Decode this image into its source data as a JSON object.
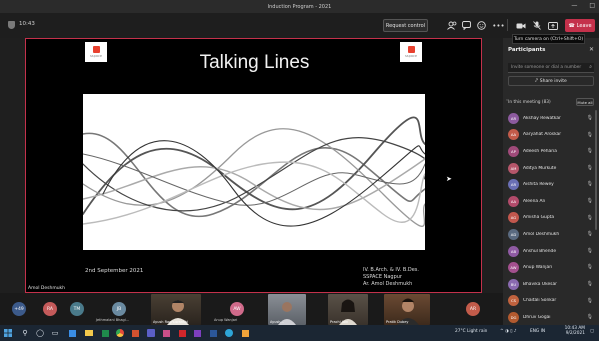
{
  "window": {
    "title": "Induction Program - 2021",
    "controls": [
      "—",
      "□"
    ]
  },
  "meeting": {
    "timer": "10:43",
    "request_control": "Request control",
    "leave_label": "Leave",
    "tooltip": "Turn camera on (Ctrl+Shift+O)"
  },
  "slide": {
    "title": "Talking Lines",
    "date": "2nd September 2021",
    "credits": [
      "IV. B.Arch. & IV. B.Des.",
      "SSPACE Nagpur",
      "Ar. Amol Deshmukh"
    ],
    "presenter": "Amol Deshmukh",
    "logo_text": "sspace"
  },
  "participants": {
    "title": "Participants",
    "invite_placeholder": "Invite someone or dial a number",
    "share_invite": "Share invite",
    "section": "In this meeting (83)",
    "mute_all": "Mute all",
    "list": [
      {
        "name": "Akshay Rewatkar",
        "initials": "AR",
        "color": "#8c5a9e"
      },
      {
        "name": "Aaryahat Aroskar",
        "initials": "AA",
        "color": "#c25b4a"
      },
      {
        "name": "Adeesh Peharia",
        "initials": "AP",
        "color": "#a04a7a"
      },
      {
        "name": "Aditya Murkute",
        "initials": "AM",
        "color": "#b5566a"
      },
      {
        "name": "Aishita Rewey",
        "initials": "AR",
        "color": "#6a6fb5"
      },
      {
        "name": "Aleena Ali",
        "initials": "AA",
        "color": "#b24b6b"
      },
      {
        "name": "Amisha Gupta",
        "initials": "AG",
        "color": "#c2574d"
      },
      {
        "name": "Amol Deshmukh",
        "initials": "AD",
        "color": "#5a6a80"
      },
      {
        "name": "Anshul Bhende",
        "initials": "AB",
        "color": "#8f5aa3"
      },
      {
        "name": "Anup Wanjari",
        "initials": "AW",
        "color": "#a3508e"
      },
      {
        "name": "Bhavika Ukesar",
        "initials": "BU",
        "color": "#8a6ab0"
      },
      {
        "name": "Chaitali Sonkar",
        "initials": "CS",
        "color": "#c0623e"
      },
      {
        "name": "Dhruv Gogai",
        "initials": "DG",
        "color": "#b35a2f"
      }
    ]
  },
  "gallery": {
    "circles": [
      {
        "label": "+49",
        "color": "#3c5a8a"
      },
      {
        "label": "RA",
        "color": "#c45a5a"
      },
      {
        "label": "TM",
        "color": "#4a7a8a"
      },
      {
        "label": "JB",
        "color": "#6a8aa0"
      },
      {
        "label": "AW",
        "color": "#d06a8a"
      },
      {
        "label": "AR",
        "color": "#c25b4a"
      }
    ],
    "captions": [
      "Jethmalani Bhagi...",
      "Ayush Raghuwanshi",
      "Anup Wanjari",
      "Ayush...",
      "Prachi Jain",
      "Pratik Dubey"
    ]
  },
  "taskbar": {
    "weather": "27°C Light rain",
    "lang": "ENG IN",
    "time": "10:43 AM",
    "date": "9/2/2021"
  }
}
